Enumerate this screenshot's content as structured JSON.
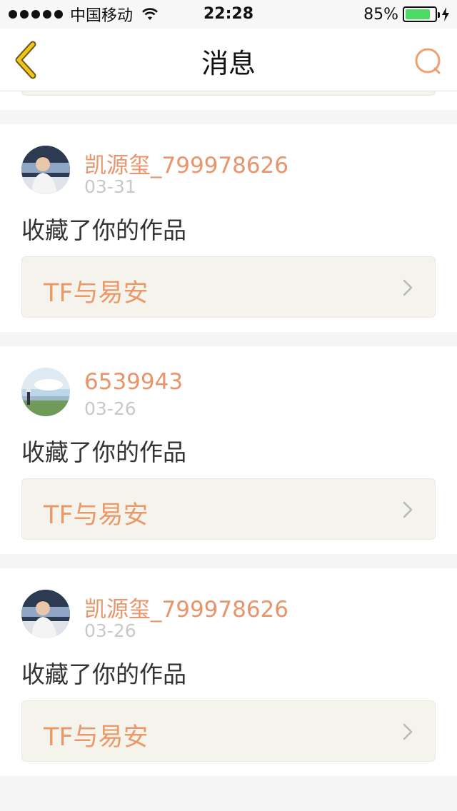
{
  "status_bar": {
    "carrier": "中国移动",
    "time": "22:28",
    "battery": "85%",
    "battery_level": 0.85
  },
  "nav": {
    "title": "消息",
    "back_icon": "chevron-left-icon",
    "search_icon": "search-icon"
  },
  "colors": {
    "accent": "#e9946a",
    "back_yellow": "#f2c318",
    "card_bg": "#f4f3ec",
    "battery_green": "#4cd964"
  },
  "messages": [
    {
      "user": "凯源玺_799978626",
      "date": "03-31",
      "action": "收藏了你的作品",
      "work": "TF与易安"
    },
    {
      "user": "6539943",
      "date": "03-26",
      "action": "收藏了你的作品",
      "work": "TF与易安"
    },
    {
      "user": "凯源玺_799978626",
      "date": "03-26",
      "action": "收藏了你的作品",
      "work": "TF与易安"
    }
  ]
}
